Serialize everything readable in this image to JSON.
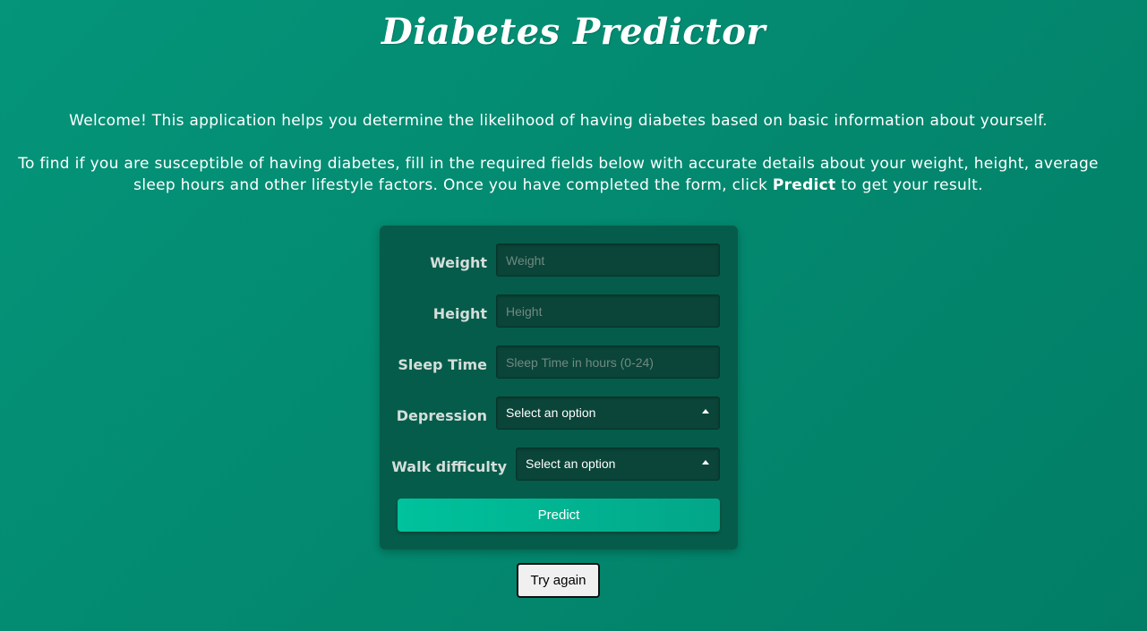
{
  "page": {
    "title": "Diabetes Predictor",
    "intro_1": "Welcome! This application helps you determine the likelihood of having diabetes based on basic information about yourself.",
    "intro_2_before": "To find if you are susceptible of having diabetes, fill in the required fields below with accurate details about your weight, height, average sleep hours and other lifestyle factors. Once you have completed the form, click ",
    "intro_2_bold": "Predict",
    "intro_2_after": " to get your result."
  },
  "form": {
    "weight": {
      "label": "Weight",
      "placeholder": "Weight",
      "value": ""
    },
    "height": {
      "label": "Height",
      "placeholder": "Height",
      "value": ""
    },
    "sleep": {
      "label": "Sleep Time",
      "placeholder": "Sleep Time in hours (0-24)",
      "value": ""
    },
    "depression": {
      "label": "Depression",
      "selected": "Select an option"
    },
    "walk": {
      "label": "Walk difficulty",
      "selected": "Select an option"
    },
    "predict_label": "Predict"
  },
  "try_again_label": "Try again",
  "colors": {
    "background": "#04957a",
    "card": "#065c4a",
    "field": "#0b4438",
    "predict_button": "#00c29c"
  },
  "icons": {
    "select_caret": "caret-up-icon"
  }
}
